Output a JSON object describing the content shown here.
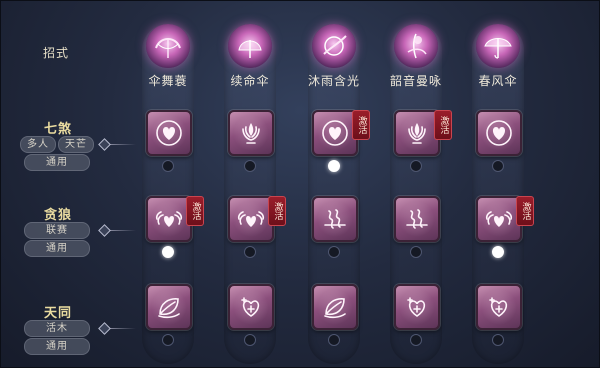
{
  "header": {
    "label": "招式"
  },
  "skills": [
    {
      "name": "伞舞蓑",
      "icon": "umbrella-dance-icon"
    },
    {
      "name": "续命伞",
      "icon": "umbrella-heal-icon"
    },
    {
      "name": "沐雨含光",
      "icon": "rain-light-icon"
    },
    {
      "name": "韶音曼咏",
      "icon": "melody-chant-icon"
    },
    {
      "name": "春风伞",
      "icon": "spring-wind-umbrella-icon"
    }
  ],
  "rows": [
    {
      "title": "七煞",
      "tags": [
        "多人",
        "天芒",
        "通用"
      ],
      "cells": [
        {
          "icon": "heart-shield-icon",
          "active": false,
          "selected": false
        },
        {
          "icon": "lotus-flame-icon",
          "active": false,
          "selected": false
        },
        {
          "icon": "heart-shield-icon",
          "active": true,
          "selected": true
        },
        {
          "icon": "lotus-flame-icon",
          "active": true,
          "selected": false
        },
        {
          "icon": "heart-shield-icon",
          "active": false,
          "selected": false
        }
      ]
    },
    {
      "title": "贪狼",
      "tags": [
        "联赛",
        "通用"
      ],
      "cells": [
        {
          "icon": "winged-heart-icon",
          "active": true,
          "selected": true
        },
        {
          "icon": "winged-heart-icon",
          "active": true,
          "selected": false
        },
        {
          "icon": "wind-swirl-icon",
          "active": false,
          "selected": false
        },
        {
          "icon": "wind-swirl-icon",
          "active": false,
          "selected": false
        },
        {
          "icon": "winged-heart-icon",
          "active": true,
          "selected": true
        }
      ]
    },
    {
      "title": "天同",
      "tags": [
        "活木",
        "通用"
      ],
      "cells": [
        {
          "icon": "leaf-swirl-icon",
          "active": false,
          "selected": false
        },
        {
          "icon": "heart-plus-icon",
          "active": false,
          "selected": false
        },
        {
          "icon": "leaf-swirl-icon",
          "active": false,
          "selected": false
        },
        {
          "icon": "heart-plus-icon",
          "active": false,
          "selected": false
        },
        {
          "icon": "heart-plus-icon",
          "active": false,
          "selected": false
        }
      ]
    }
  ],
  "badge_text": "激活",
  "colors": {
    "accent_pink": "#c766b7",
    "badge_red": "#8a1622",
    "row_title": "#eadca0"
  }
}
